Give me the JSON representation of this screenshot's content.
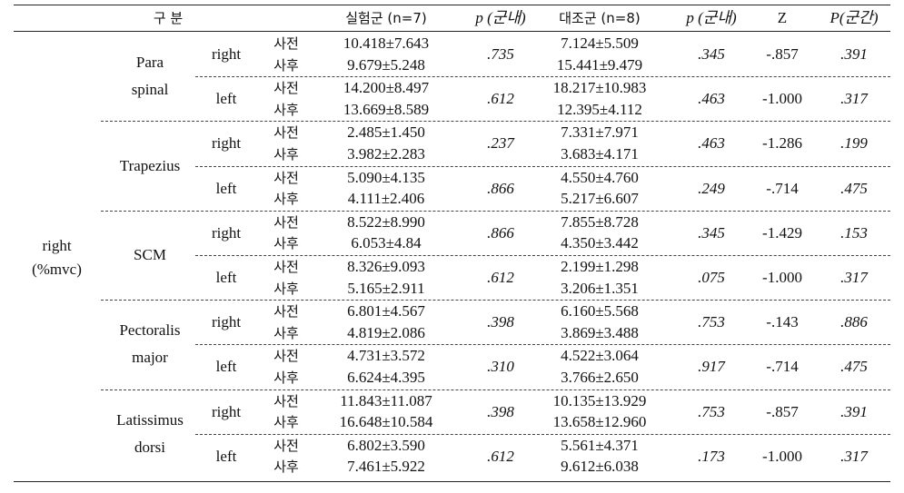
{
  "header": {
    "category": "구 분",
    "exp_group": "실험군 (n=7)",
    "p_within_1": "p (군내)",
    "ctrl_group": "대조군 (n=8)",
    "p_within_2": "p (군내)",
    "z": "Z",
    "p_between": "P(군간)"
  },
  "group_label": {
    "line1": "right",
    "line2": "(%mvc)"
  },
  "time_labels": {
    "pre": "사전",
    "post": "사후"
  },
  "muscles": [
    {
      "name_line1": "Para",
      "name_line2": "spinal",
      "sides": [
        {
          "side": "right",
          "exp_pre": "10.418±7.643",
          "exp_post": "9.679±5.248",
          "p1": ".735",
          "ctrl_pre": "7.124±5.509",
          "ctrl_post": "15.441±9.479",
          "p2": ".345",
          "z": "-.857",
          "p_between": ".391"
        },
        {
          "side": "left",
          "exp_pre": "14.200±8.497",
          "exp_post": "13.669±8.589",
          "p1": ".612",
          "ctrl_pre": "18.217±10.983",
          "ctrl_post": "12.395±4.112",
          "p2": ".463",
          "z": "-1.000",
          "p_between": ".317"
        }
      ]
    },
    {
      "name_line1": "Trapezius",
      "name_line2": "",
      "sides": [
        {
          "side": "right",
          "exp_pre": "2.485±1.450",
          "exp_post": "3.982±2.283",
          "p1": ".237",
          "ctrl_pre": "7.331±7.971",
          "ctrl_post": "3.683±4.171",
          "p2": ".463",
          "z": "-1.286",
          "p_between": ".199"
        },
        {
          "side": "left",
          "exp_pre": "5.090±4.135",
          "exp_post": "4.111±2.406",
          "p1": ".866",
          "ctrl_pre": "4.550±4.760",
          "ctrl_post": "5.217±6.607",
          "p2": ".249",
          "z": "-.714",
          "p_between": ".475"
        }
      ]
    },
    {
      "name_line1": "SCM",
      "name_line2": "",
      "sides": [
        {
          "side": "right",
          "exp_pre": "8.522±8.990",
          "exp_post": "6.053±4.84",
          "p1": ".866",
          "ctrl_pre": "7.855±8.728",
          "ctrl_post": "4.350±3.442",
          "p2": ".345",
          "z": "-1.429",
          "p_between": ".153"
        },
        {
          "side": "left",
          "exp_pre": "8.326±9.093",
          "exp_post": "5.165±2.911",
          "p1": ".612",
          "ctrl_pre": "2.199±1.298",
          "ctrl_post": "3.206±1.351",
          "p2": ".075",
          "z": "-1.000",
          "p_between": ".317"
        }
      ]
    },
    {
      "name_line1": "Pectoralis",
      "name_line2": "major",
      "sides": [
        {
          "side": "right",
          "exp_pre": "6.801±4.567",
          "exp_post": "4.819±2.086",
          "p1": ".398",
          "ctrl_pre": "6.160±5.568",
          "ctrl_post": "3.869±3.488",
          "p2": ".753",
          "z": "-.143",
          "p_between": ".886"
        },
        {
          "side": "left",
          "exp_pre": "4.731±3.572",
          "exp_post": "6.624±4.395",
          "p1": ".310",
          "ctrl_pre": "4.522±3.064",
          "ctrl_post": "3.766±2.650",
          "p2": ".917",
          "z": "-.714",
          "p_between": ".475"
        }
      ]
    },
    {
      "name_line1": "Latissimus",
      "name_line2": "dorsi",
      "sides": [
        {
          "side": "right",
          "exp_pre": "11.843±11.087",
          "exp_post": "16.648±10.584",
          "p1": ".398",
          "ctrl_pre": "10.135±13.929",
          "ctrl_post": "13.658±12.960",
          "p2": ".753",
          "z": "-.857",
          "p_between": ".391"
        },
        {
          "side": "left",
          "exp_pre": "6.802±3.590",
          "exp_post": "7.461±5.922",
          "p1": ".612",
          "ctrl_pre": "5.561±4.371",
          "ctrl_post": "9.612±6.038",
          "p2": ".173",
          "z": "-1.000",
          "p_between": ".317"
        }
      ]
    }
  ]
}
